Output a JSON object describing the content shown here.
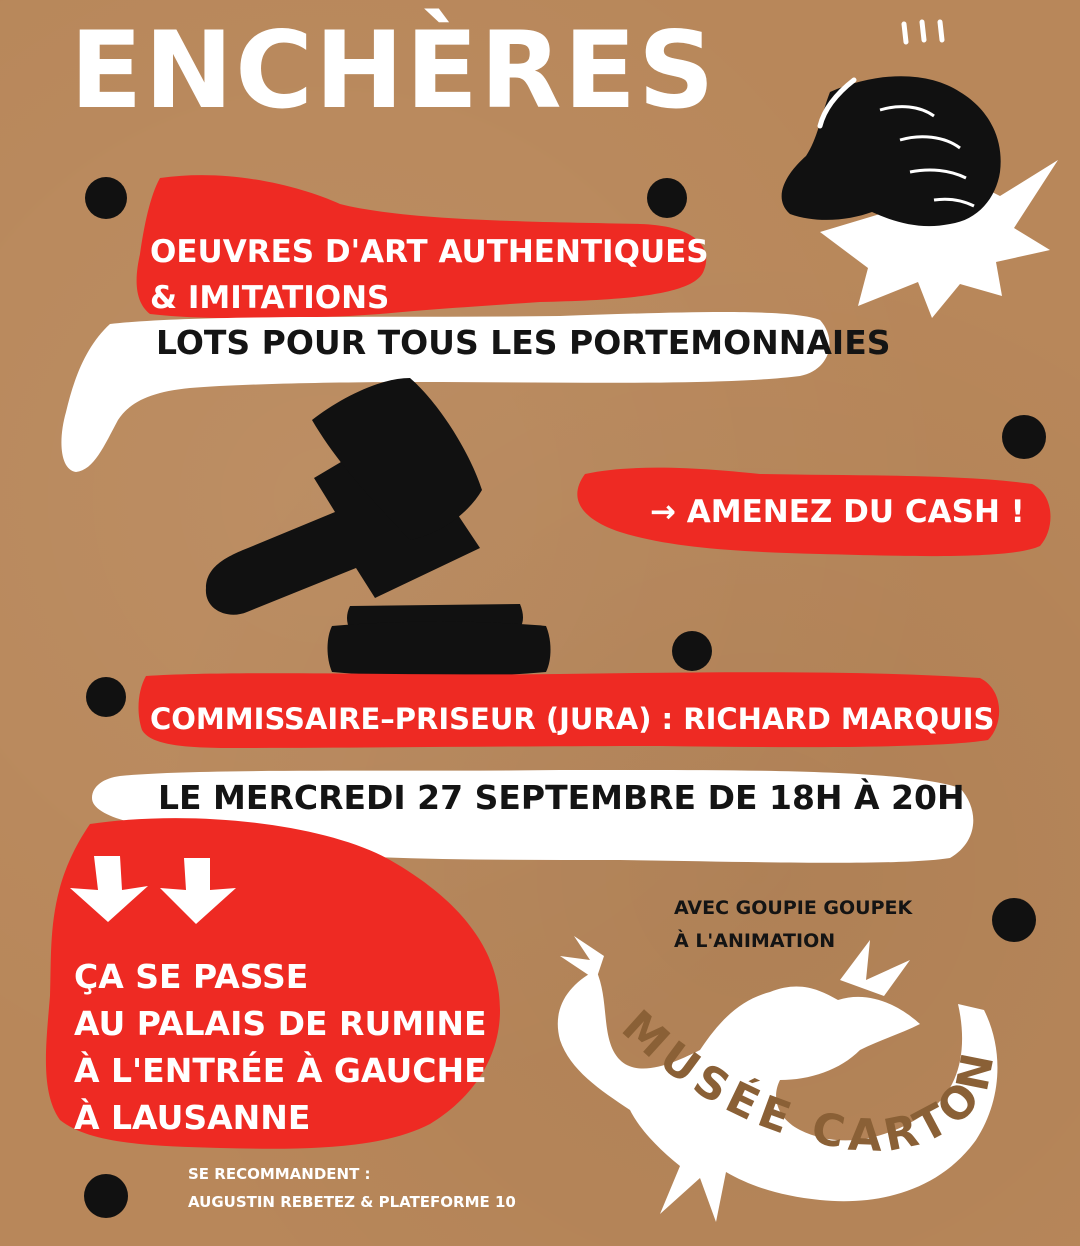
{
  "poster": {
    "title": "ENCHÈRES",
    "art_lines": [
      "OEUVRES D'ART AUTHENTIQUES",
      "& IMITATIONS"
    ],
    "lots": "LOTS POUR TOUS LES PORTEMONNAIES",
    "cash": "→ AMENEZ DU CASH !",
    "auctioneer": "COMMISSAIRE–PRISEUR (JURA) : RICHARD MARQUIS",
    "date": "LE MERCREDI 27 SEPTEMBRE DE 18H À 20H",
    "place_lines": [
      "ÇA SE PASSE",
      "AU PALAIS DE RUMINE",
      "À L'ENTRÉE À GAUCHE",
      "À LAUSANNE"
    ],
    "animation_lines": [
      "AVEC GOUPIE GOUPEK",
      "À L'ANIMATION"
    ],
    "recommend_lines": [
      "SE RECOMMANDENT :",
      "AUGUSTIN REBETEZ & PLATEFORME 10"
    ],
    "logo_text": "MUSÉE CARTON"
  },
  "icons": [
    "pushpin-icon",
    "fist-icon",
    "impact-burst-icon",
    "gavel-icon",
    "gavel-block-icon",
    "down-arrow-icon",
    "dragon-icon"
  ],
  "colors": {
    "cardboard": "#b8875a",
    "red": "#ee2a23",
    "white": "#ffffff",
    "black": "#141414",
    "logo_brown": "#8a6036"
  }
}
